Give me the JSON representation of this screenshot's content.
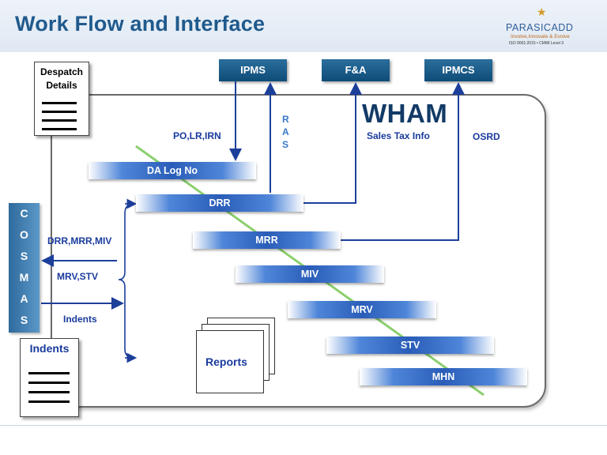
{
  "header": {
    "title": "Work Flow and Interface",
    "logo": {
      "brand": "PARASICADD",
      "tagline": "Involve,Innovate & Evolve",
      "certs": "ISO 9001:2015 • CMMI Level 3"
    }
  },
  "diagram": {
    "system_name": "WHAM",
    "external_systems": [
      "IPMS",
      "F&A",
      "IPMCS"
    ],
    "flow_labels": {
      "ipms_in": "PO,LR,IRN",
      "ras": [
        "R",
        "A",
        "S"
      ],
      "fa": "Sales Tax Info",
      "ipmcs": "OSRD"
    },
    "process_bars": [
      "DA Log No",
      "DRR",
      "MRR",
      "MIV",
      "MRV",
      "STV",
      "MHN"
    ],
    "cosmas_letters": [
      "C",
      "O",
      "S",
      "M",
      "A",
      "S"
    ],
    "cosmas_labels": {
      "out_1": "DRR,MRR,MIV",
      "out_2": "MRV,STV",
      "in": "Indents"
    },
    "documents": {
      "despatch": [
        "Despatch",
        "Details"
      ],
      "indents": "Indents",
      "reports": "Reports"
    }
  }
}
